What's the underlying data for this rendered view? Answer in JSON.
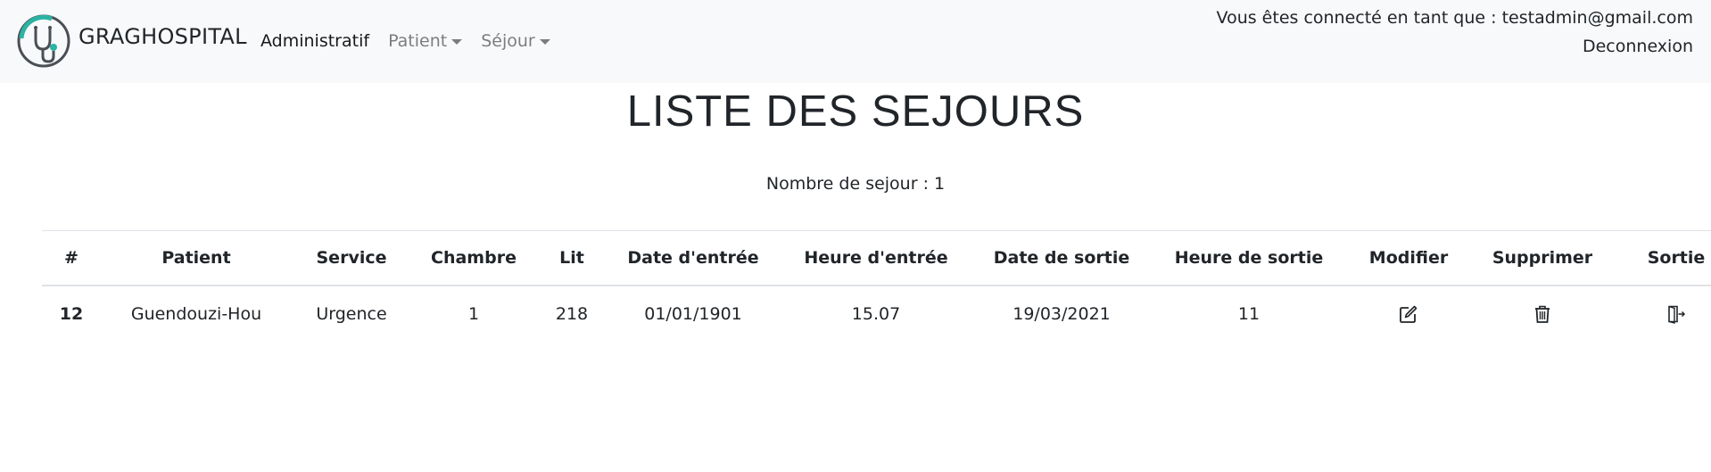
{
  "brand": {
    "name": "GRAGHOSPITAL"
  },
  "nav": {
    "administratif": "Administratif",
    "patient": "Patient",
    "sejour": "Séjour"
  },
  "user": {
    "connected": "Vous êtes connecté en tant que : testadmin@gmail.com",
    "logout": "Deconnexion"
  },
  "page": {
    "title": "LISTE DES SEJOURS",
    "count": "Nombre de sejour : 1"
  },
  "table": {
    "headers": [
      "#",
      "Patient",
      "Service",
      "Chambre",
      "Lit",
      "Date d'entrée",
      "Heure d'entrée",
      "Date de sortie",
      "Heure de sortie",
      "Modifier",
      "Supprimer",
      "Sortie"
    ],
    "rows": [
      {
        "id": "12",
        "patient": "Guendouzi-Hou",
        "service": "Urgence",
        "chambre": "1",
        "lit": "218",
        "date_entree": "01/01/1901",
        "heure_entree": "15.07",
        "date_sortie": "19/03/2021",
        "heure_sortie": "11"
      }
    ]
  },
  "icons": {
    "logo": "stethoscope-logo-icon",
    "modifier": "edit-icon",
    "supprimer": "trash-icon",
    "sortie": "exit-door-icon"
  },
  "colors": {
    "navbar_bg": "#f8f9fa",
    "logo_accent": "#2bb3a3",
    "logo_dark": "#4a4f55"
  }
}
